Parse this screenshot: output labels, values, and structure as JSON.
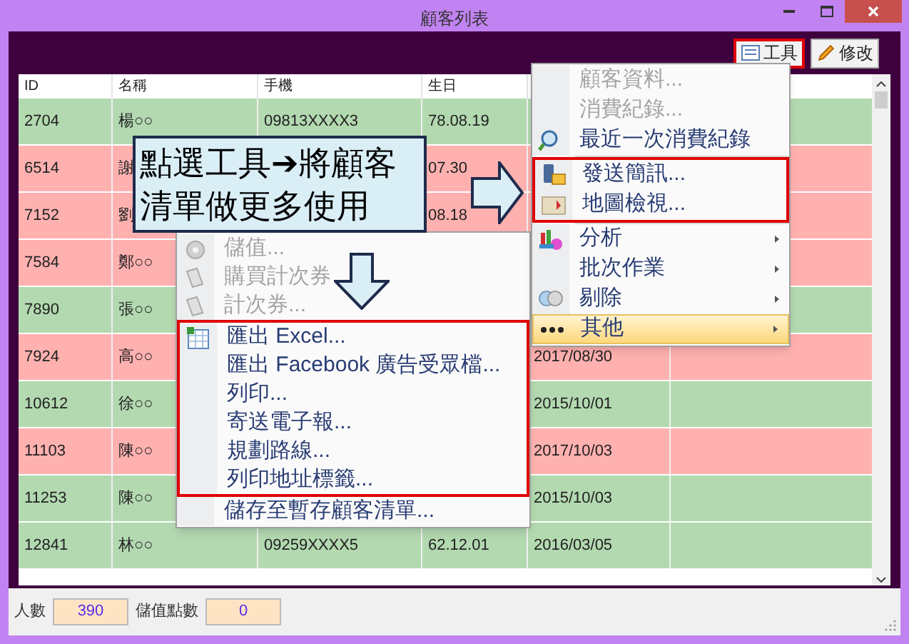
{
  "window": {
    "title": "顧客列表"
  },
  "toolbar": [
    {
      "label": "工具",
      "boxed": true
    },
    {
      "label": "修改",
      "boxed": false
    }
  ],
  "table": {
    "columns": [
      "ID",
      "名稱",
      "手機",
      "生日"
    ],
    "rows": [
      {
        "color": "#b3d9b0",
        "id": "2704",
        "name": "楊○○",
        "phone": "09813XXXX3",
        "birthday": "78.08.19"
      },
      {
        "color": "#ffb1b0",
        "id": "6514",
        "name": "謝",
        "birthday": "07.30"
      },
      {
        "color": "#ffb1b0",
        "id": "7152",
        "name": "劉",
        "birthday": "08.18"
      },
      {
        "color": "#ffb1b0",
        "id": "7584",
        "name": "鄭○○"
      },
      {
        "color": "#b3d9b0",
        "id": "7890",
        "name": "張○○"
      },
      {
        "color": "#ffb1b0",
        "id": "7924",
        "name": "高○○",
        "column_5": "2017/08/30"
      },
      {
        "color": "#b3d9b0",
        "id": "10612",
        "name": "徐○○",
        "column_5": "2015/10/01"
      },
      {
        "color": "#ffb1b0",
        "id": "11103",
        "name": "陳○○",
        "column_5": "2017/10/03"
      },
      {
        "color": "#b3d9b0",
        "id": "11253",
        "name": "陳○○",
        "column_5": "2015/10/03"
      },
      {
        "color": "#b3d9b0",
        "id": "12841",
        "name": "林○○",
        "phone": "09259XXXX5",
        "birthday": "62.12.01",
        "column_5": "2016/03/05"
      }
    ]
  },
  "status_bar": [
    {
      "label": "人數",
      "value": "390"
    },
    {
      "label": "儲值點數",
      "value": "0"
    }
  ],
  "tools_menu": {
    "items": [
      {
        "label": "顧客資料...",
        "disabled": true,
        "boxed": false,
        "has_submenu": false,
        "highlighted": false,
        "separator_before": false
      },
      {
        "label": "消費紀錄...",
        "disabled": true,
        "boxed": false,
        "has_submenu": false,
        "highlighted": false,
        "separator_before": false
      },
      {
        "label": "最近一次消費紀錄",
        "disabled": false,
        "boxed": false,
        "has_submenu": false,
        "highlighted": false,
        "separator_before": false
      },
      {
        "label": "發送簡訊...",
        "disabled": false,
        "boxed": true,
        "has_submenu": false,
        "highlighted": false,
        "separator_before": true
      },
      {
        "label": "地圖檢視...",
        "disabled": false,
        "boxed": true,
        "has_submenu": false,
        "highlighted": false,
        "separator_before": false
      },
      {
        "label": "分析",
        "disabled": false,
        "boxed": false,
        "has_submenu": true,
        "highlighted": false,
        "separator_before": true
      },
      {
        "label": "批次作業",
        "disabled": false,
        "boxed": false,
        "has_submenu": true,
        "highlighted": false,
        "separator_before": false
      },
      {
        "label": "剔除",
        "disabled": false,
        "boxed": false,
        "has_submenu": true,
        "highlighted": false,
        "separator_before": false
      },
      {
        "label": "其他",
        "disabled": false,
        "boxed": false,
        "has_submenu": true,
        "highlighted": true,
        "separator_before": false
      }
    ]
  },
  "other_submenu": {
    "items": [
      {
        "label": "儲值...",
        "disabled": true,
        "boxed": false
      },
      {
        "label": "購買計次券",
        "disabled": true,
        "boxed": false
      },
      {
        "label": "計次券...",
        "disabled": true,
        "boxed": false
      },
      {
        "label": "匯出 Excel...",
        "disabled": false,
        "boxed": true
      },
      {
        "label": "匯出 Facebook 廣告受眾檔...",
        "disabled": false,
        "boxed": true
      },
      {
        "label": "列印...",
        "disabled": false,
        "boxed": true
      },
      {
        "label": "寄送電子報...",
        "disabled": false,
        "boxed": true
      },
      {
        "label": "規劃路線...",
        "disabled": false,
        "boxed": true
      },
      {
        "label": "列印地址標籤...",
        "disabled": false,
        "boxed": true
      },
      {
        "label": "儲存至暫存顧客清單...",
        "disabled": false,
        "boxed": false
      }
    ]
  },
  "callout": {
    "lines": [
      "點選工具➔將顧客",
      "清單做更多使用"
    ]
  }
}
